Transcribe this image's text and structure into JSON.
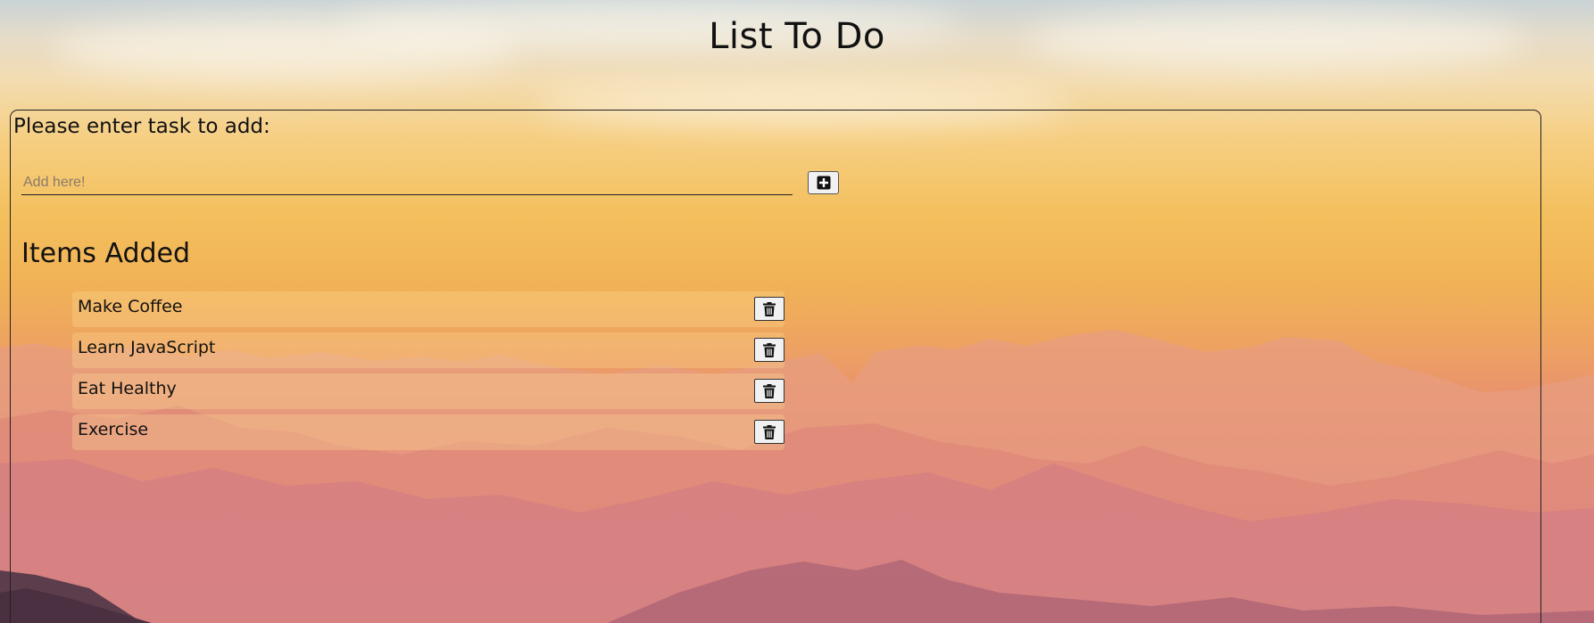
{
  "app": {
    "title": "List To Do"
  },
  "entry": {
    "prompt": "Please enter task to add:",
    "placeholder": "Add here!",
    "value": "",
    "add_icon": "plus-square-icon"
  },
  "list": {
    "heading": "Items Added",
    "delete_icon": "trash-icon",
    "items": [
      {
        "label": "Make Coffee"
      },
      {
        "label": "Learn JavaScript"
      },
      {
        "label": "Eat Healthy"
      },
      {
        "label": "Exercise"
      }
    ]
  },
  "colors": {
    "sky_top": "#c9d3d6",
    "sun_glow": "#f4c05e",
    "mountain_far": "#e39a84",
    "mountain_near": "#9c5870",
    "text": "#111111"
  }
}
